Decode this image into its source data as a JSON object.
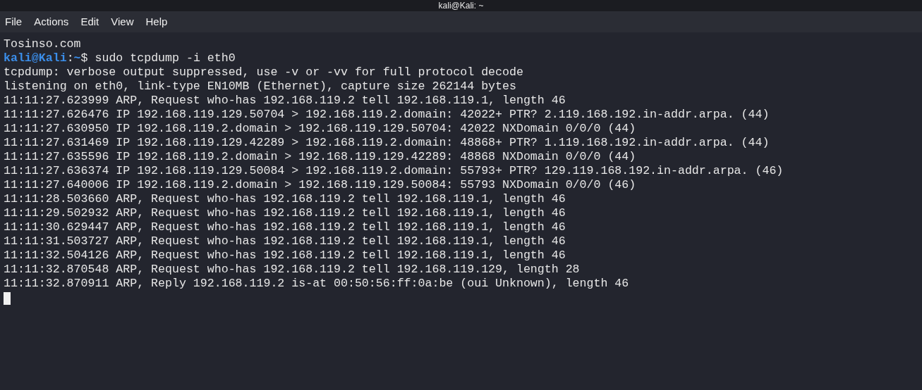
{
  "window": {
    "title": "kali@Kali: ~"
  },
  "menu": [
    "File",
    "Actions",
    "Edit",
    "View",
    "Help"
  ],
  "terminal": {
    "lines": [
      {
        "kind": "output",
        "text": "Tosinso.com"
      },
      {
        "kind": "prompt",
        "user": "kali@Kali",
        "sep": ":",
        "path": "~",
        "symbol": "$",
        "command": " sudo tcpdump -i eth0"
      },
      {
        "kind": "output",
        "text": "tcpdump: verbose output suppressed, use -v or -vv for full protocol decode"
      },
      {
        "kind": "output",
        "text": "listening on eth0, link-type EN10MB (Ethernet), capture size 262144 bytes"
      },
      {
        "kind": "output",
        "text": "11:11:27.623999 ARP, Request who-has 192.168.119.2 tell 192.168.119.1, length 46"
      },
      {
        "kind": "output",
        "text": "11:11:27.626476 IP 192.168.119.129.50704 > 192.168.119.2.domain: 42022+ PTR? 2.119.168.192.in-addr.arpa. (44)"
      },
      {
        "kind": "output",
        "text": "11:11:27.630950 IP 192.168.119.2.domain > 192.168.119.129.50704: 42022 NXDomain 0/0/0 (44)"
      },
      {
        "kind": "output",
        "text": "11:11:27.631469 IP 192.168.119.129.42289 > 192.168.119.2.domain: 48868+ PTR? 1.119.168.192.in-addr.arpa. (44)"
      },
      {
        "kind": "output",
        "text": "11:11:27.635596 IP 192.168.119.2.domain > 192.168.119.129.42289: 48868 NXDomain 0/0/0 (44)"
      },
      {
        "kind": "output",
        "text": "11:11:27.636374 IP 192.168.119.129.50084 > 192.168.119.2.domain: 55793+ PTR? 129.119.168.192.in-addr.arpa. (46)"
      },
      {
        "kind": "output",
        "text": "11:11:27.640006 IP 192.168.119.2.domain > 192.168.119.129.50084: 55793 NXDomain 0/0/0 (46)"
      },
      {
        "kind": "output",
        "text": "11:11:28.503660 ARP, Request who-has 192.168.119.2 tell 192.168.119.1, length 46"
      },
      {
        "kind": "output",
        "text": "11:11:29.502932 ARP, Request who-has 192.168.119.2 tell 192.168.119.1, length 46"
      },
      {
        "kind": "output",
        "text": "11:11:30.629447 ARP, Request who-has 192.168.119.2 tell 192.168.119.1, length 46"
      },
      {
        "kind": "output",
        "text": "11:11:31.503727 ARP, Request who-has 192.168.119.2 tell 192.168.119.1, length 46"
      },
      {
        "kind": "output",
        "text": "11:11:32.504126 ARP, Request who-has 192.168.119.2 tell 192.168.119.1, length 46"
      },
      {
        "kind": "output",
        "text": "11:11:32.870548 ARP, Request who-has 192.168.119.2 tell 192.168.119.129, length 28"
      },
      {
        "kind": "output",
        "text": "11:11:32.870911 ARP, Reply 192.168.119.2 is-at 00:50:56:ff:0a:be (oui Unknown), length 46"
      }
    ],
    "cursor": true
  }
}
